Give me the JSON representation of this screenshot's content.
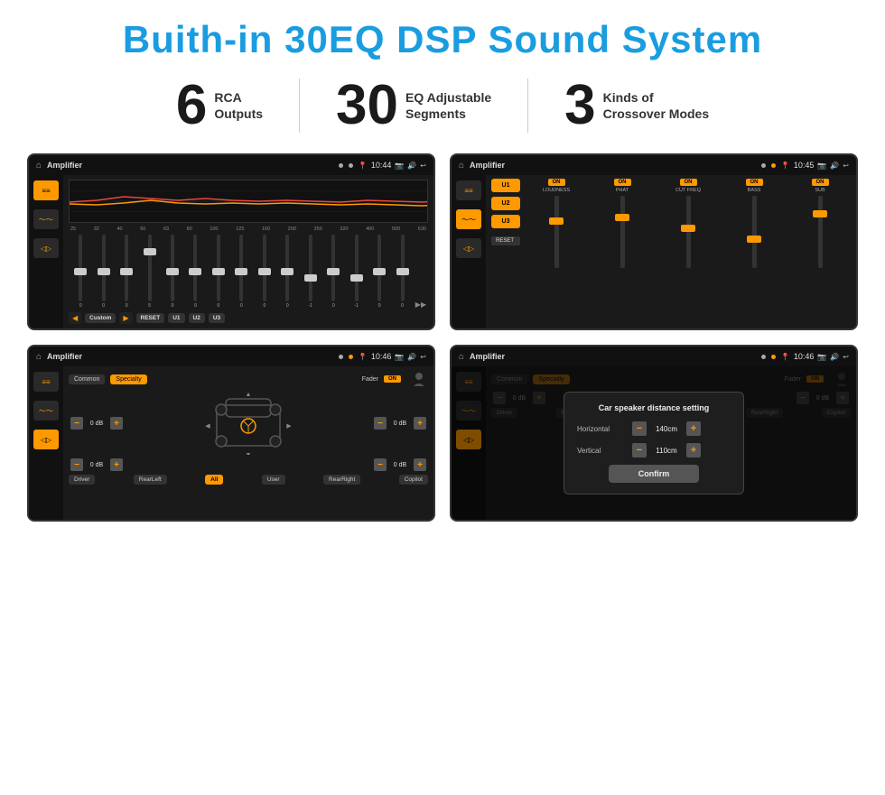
{
  "page": {
    "title": "Buith-in 30EQ DSP Sound System",
    "stats": [
      {
        "number": "6",
        "label": "RCA\nOutputs"
      },
      {
        "number": "30",
        "label": "EQ Adjustable\nSegments"
      },
      {
        "number": "3",
        "label": "Kinds of\nCrossover Modes"
      }
    ],
    "screens": [
      {
        "id": "screen1",
        "statusBar": {
          "title": "Amplifier",
          "time": "10:44"
        },
        "type": "eq"
      },
      {
        "id": "screen2",
        "statusBar": {
          "title": "Amplifier",
          "time": "10:45"
        },
        "type": "crossover"
      },
      {
        "id": "screen3",
        "statusBar": {
          "title": "Amplifier",
          "time": "10:46"
        },
        "type": "fader"
      },
      {
        "id": "screen4",
        "statusBar": {
          "title": "Amplifier",
          "time": "10:46"
        },
        "type": "fader-dialog"
      }
    ],
    "eq": {
      "freqs": [
        "25",
        "32",
        "40",
        "50",
        "63",
        "80",
        "100",
        "125",
        "160",
        "200",
        "250",
        "320",
        "400",
        "500",
        "630"
      ],
      "values": [
        "0",
        "0",
        "0",
        "5",
        "0",
        "0",
        "0",
        "0",
        "0",
        "0",
        "-1",
        "0",
        "-1",
        "",
        ""
      ],
      "presetLabel": "Custom",
      "buttons": [
        "RESET",
        "U1",
        "U2",
        "U3"
      ]
    },
    "crossover": {
      "uButtons": [
        "U1",
        "U2",
        "U3"
      ],
      "channels": [
        {
          "label": "LOUDNESS",
          "on": true
        },
        {
          "label": "PHAT",
          "on": true
        },
        {
          "label": "CUT FREQ",
          "on": true
        },
        {
          "label": "BASS",
          "on": true
        },
        {
          "label": "SUB",
          "on": true
        }
      ],
      "resetLabel": "RESET"
    },
    "fader": {
      "tabs": [
        "Common",
        "Specialty"
      ],
      "activeTab": "Specialty",
      "faderLabel": "Fader",
      "onLabel": "ON",
      "volumeValues": [
        "0 dB",
        "0 dB",
        "0 dB",
        "0 dB"
      ],
      "bottomButtons": [
        "Driver",
        "RearLeft",
        "All",
        "User",
        "RearRight",
        "Copilot"
      ]
    },
    "dialog": {
      "title": "Car speaker distance setting",
      "horizontal": {
        "label": "Horizontal",
        "value": "140cm"
      },
      "vertical": {
        "label": "Vertical",
        "value": "110cm"
      },
      "confirmLabel": "Confirm"
    }
  }
}
